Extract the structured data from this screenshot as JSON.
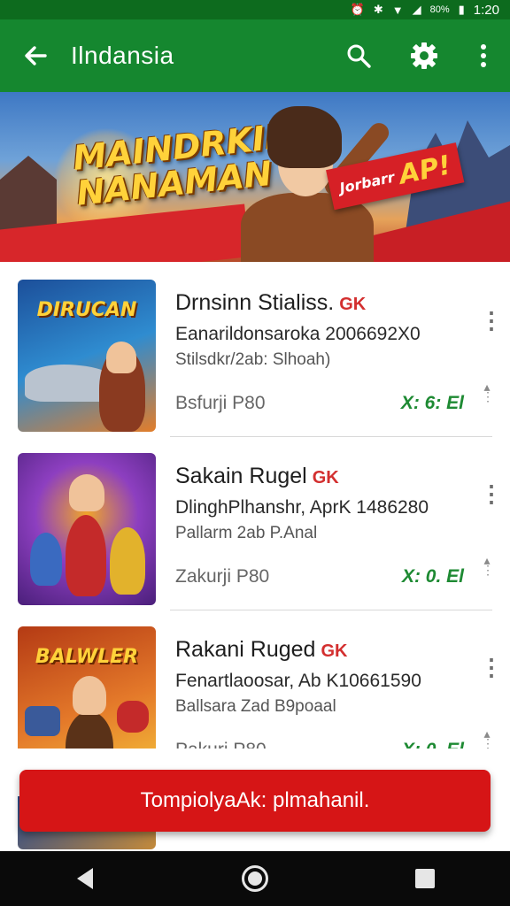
{
  "status_bar": {
    "time": "1:20",
    "battery": "80%"
  },
  "app_bar": {
    "title": "Ilndansia",
    "back_icon": "arrow-left-icon",
    "search_icon": "search-icon",
    "settings_icon": "gear-icon",
    "more_icon": "more-vertical-icon"
  },
  "banner": {
    "headline_line1": "MAINDRKII",
    "headline_line2": "NANAMAN",
    "promo_small": "Jorbarr",
    "promo_big": "AP!"
  },
  "list": {
    "items": [
      {
        "name": "Drnsinn Stialiss.",
        "tag": "GK",
        "line1": "Eanarildonsaroka 2006692X0",
        "line2": "Stilsdkr/2ab: Slhoah)",
        "price": "Bsfurji P80",
        "rating": "X: 6: El",
        "thumb_label": "DIRUCAN",
        "thumb_colors": [
          "#1c4f9a",
          "#2f8cd0",
          "#e27d2a"
        ]
      },
      {
        "name": "Sakain Rugel",
        "tag": "GK",
        "line1": "DlinghPlhanshr, AprK 1486280",
        "line2": "Pallarm 2ab P.Anal",
        "price": "Zakurji P80",
        "rating": "X: 0. El",
        "thumb_label": "",
        "thumb_colors": [
          "#4a1f7a",
          "#8d3fc0",
          "#f0a52a"
        ]
      },
      {
        "name": "Rakani Ruged",
        "tag": "GK",
        "line1": "Fenartlaoosar, Ab K10661590",
        "line2": "Ballsara Zad B9poaal",
        "price": "Pakuri P80",
        "rating": "X: 0. El",
        "thumb_label": "BALWLER",
        "thumb_colors": [
          "#b43a14",
          "#e4792a",
          "#f5c23a"
        ]
      }
    ]
  },
  "toast": {
    "label": "TompiolyaAk: plmahanil."
  },
  "colors": {
    "app_bar": "#15872f",
    "status_bar": "#0d6b1e",
    "accent_red": "#d61516",
    "rating_green": "#1e8a33"
  }
}
